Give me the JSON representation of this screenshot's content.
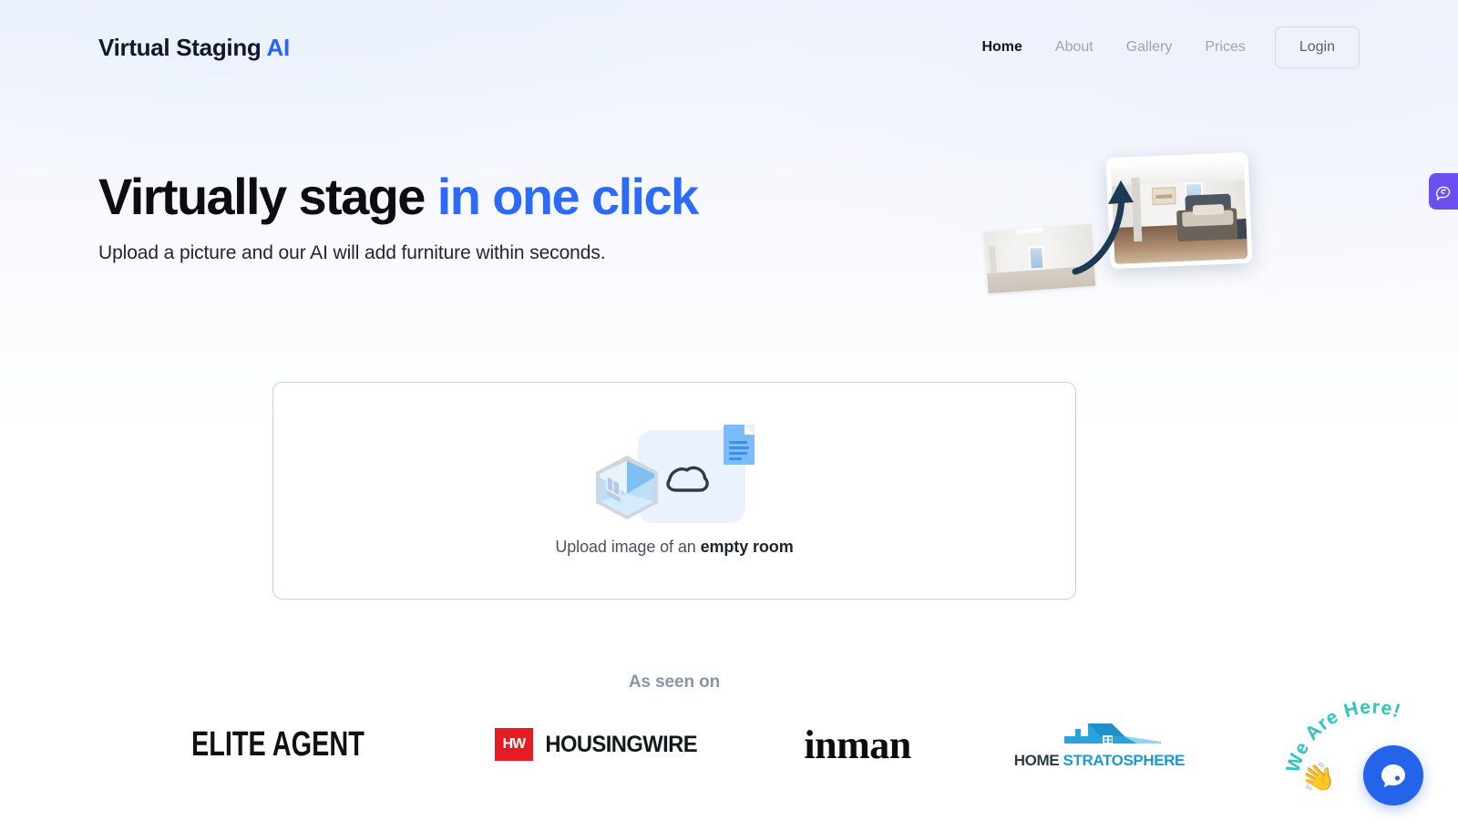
{
  "header": {
    "logo_main": "Virtual Staging",
    "logo_accent": "AI",
    "nav": [
      {
        "label": "Home",
        "active": true
      },
      {
        "label": "About",
        "active": false
      },
      {
        "label": "Gallery",
        "active": false
      },
      {
        "label": "Prices",
        "active": false
      }
    ],
    "login_label": "Login"
  },
  "hero": {
    "headline_main": "Virtually stage",
    "headline_accent": "in one click",
    "subtitle": "Upload a picture and our AI will add furniture within seconds.",
    "image_before_alt": "empty room photo",
    "image_after_alt": "virtually staged bedroom photo"
  },
  "upload": {
    "text_prefix": "Upload image of an ",
    "text_bold": "empty room",
    "icons": {
      "cloud": "cloud-icon",
      "document": "document-icon",
      "room_cube": "isometric-room-icon"
    }
  },
  "press": {
    "label": "As seen on",
    "logos": [
      {
        "name": "Elite Agent",
        "text": "ELITE AGENT"
      },
      {
        "name": "HousingWire",
        "badge": "HW",
        "text": "HOUSINGWIRE"
      },
      {
        "name": "Inman",
        "text": "inman"
      },
      {
        "name": "Home Stratosphere",
        "text_dark": "HOME",
        "text_blue": "STRATOSPHERE"
      }
    ]
  },
  "widgets": {
    "feedback_tab_icon": "brain-chat-icon",
    "chat_bubble_text": "We Are Here!",
    "chat_button_icon": "chat-bubble-icon",
    "wave_icon": "waving-hand-icon"
  },
  "colors": {
    "accent_blue": "#2563ff",
    "headline_accent": "#2b6bf6",
    "dropzone_border": "#bed3f5",
    "press_label": "#8b93a7",
    "chat_teal": "#2ec4c0",
    "chat_button": "#2563eb",
    "feedback_purple": "#6c4ff0",
    "housingwire_red": "#e51c23",
    "stratosphere_blue": "#1c9ad6"
  }
}
